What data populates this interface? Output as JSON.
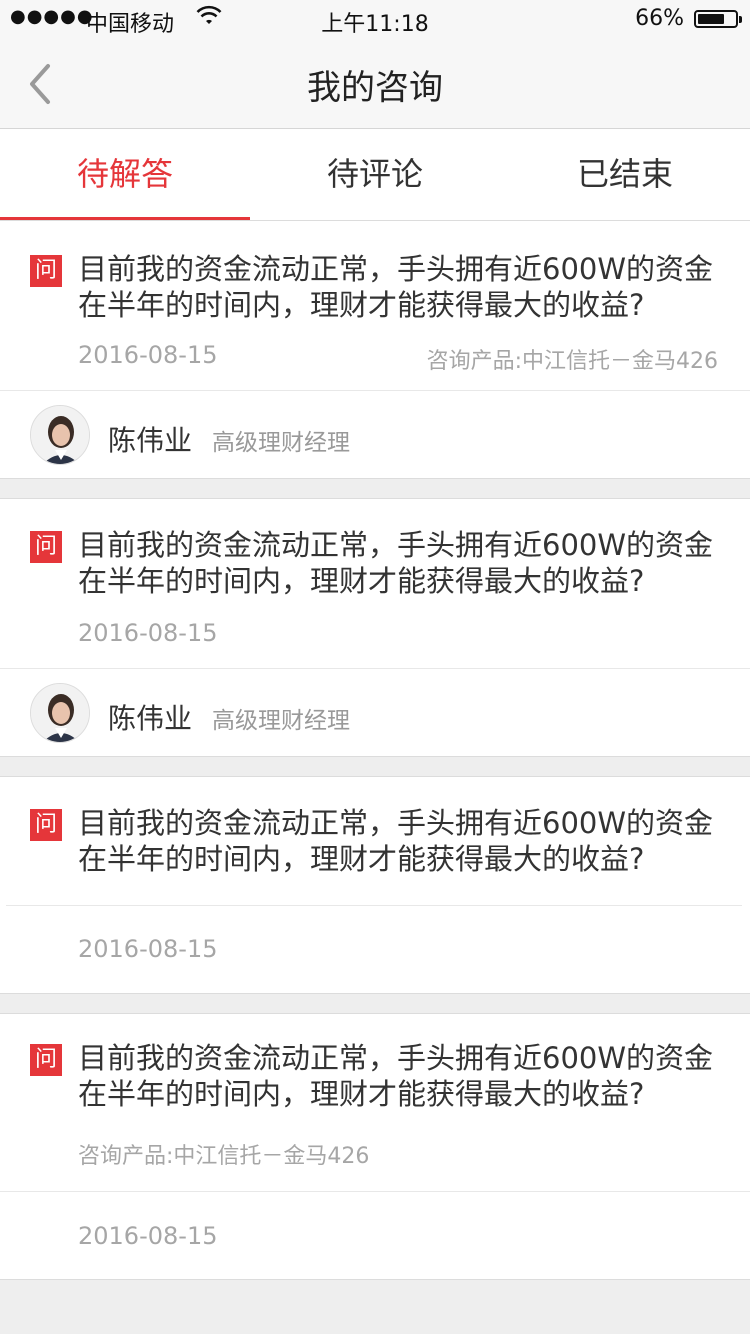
{
  "status_bar": {
    "signal": "●●●●●",
    "carrier": "中国移动",
    "time": "上午11:18",
    "battery_pct": "66%",
    "battery_level": 0.66
  },
  "nav": {
    "title": "我的咨询"
  },
  "tabs": [
    {
      "label": "待解答",
      "active": true
    },
    {
      "label": "待评论",
      "active": false
    },
    {
      "label": "已结束",
      "active": false
    }
  ],
  "cards": [
    {
      "icon": "问",
      "question_line1": "目前我的资金流动正常，手头拥有近600W的资金",
      "question_line2": "在半年的时间内，理财才能获得最大的收益?",
      "date": "2016-08-15",
      "product": "咨询产品:中江信托－金马426",
      "advisor_name": "陈伟业",
      "advisor_rank": "高级理财经理"
    },
    {
      "icon": "问",
      "question_line1": "目前我的资金流动正常，手头拥有近600W的资金",
      "question_line2": "在半年的时间内，理财才能获得最大的收益?",
      "date": "2016-08-15",
      "advisor_name": "陈伟业",
      "advisor_rank": "高级理财经理"
    },
    {
      "icon": "问",
      "question_line1": "目前我的资金流动正常，手头拥有近600W的资金",
      "question_line2": "在半年的时间内，理财才能获得最大的收益?",
      "date": "2016-08-15"
    },
    {
      "icon": "问",
      "question_line1": "目前我的资金流动正常，手头拥有近600W的资金",
      "question_line2": "在半年的时间内，理财才能获得最大的收益?",
      "product": "咨询产品:中江信托－金马426",
      "date": "2016-08-15"
    }
  ],
  "colors": {
    "accent": "#e5363a",
    "muted": "#a6a6a6"
  }
}
